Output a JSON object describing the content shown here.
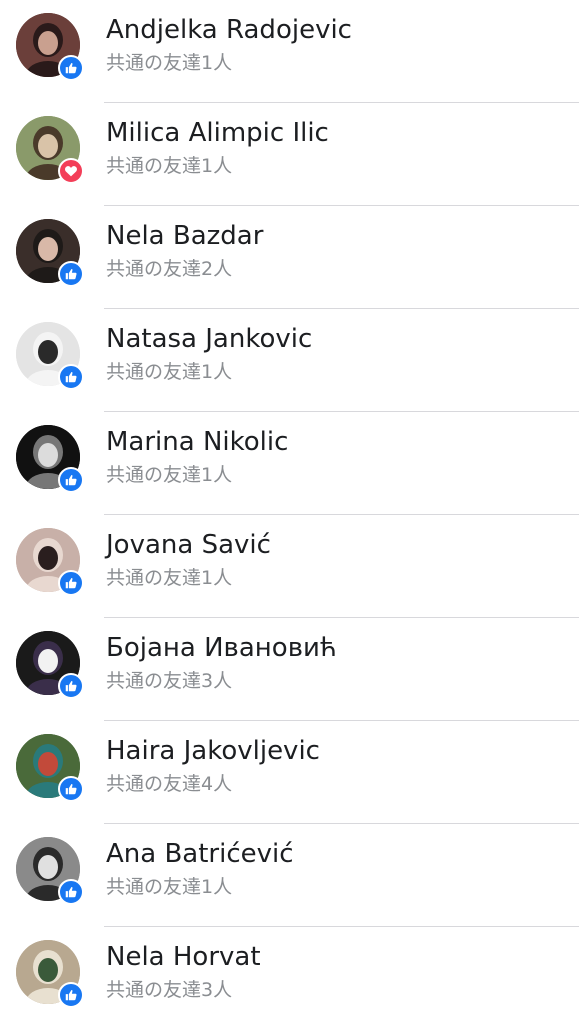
{
  "colors": {
    "like_badge": "#1877f2",
    "love_badge": "#f33e58",
    "name_text": "#1c1e21",
    "secondary_text": "#8a8d91",
    "divider": "#d8d8dc"
  },
  "reactors": [
    {
      "name": "Andjelka Radojevic",
      "mutual": "共通の友達1人",
      "reaction": "like",
      "avatar": [
        "#6b3f3a",
        "#c9a08f",
        "#2a1a1a"
      ]
    },
    {
      "name": "Milica Alimpic Ilic",
      "mutual": "共通の友達1人",
      "reaction": "love",
      "avatar": [
        "#8a9a6a",
        "#d9c3a8",
        "#4a3a2a"
      ]
    },
    {
      "name": "Nela Bazdar",
      "mutual": "共通の友達2人",
      "reaction": "like",
      "avatar": [
        "#3a2e2a",
        "#d8b8a8",
        "#1e1a18"
      ]
    },
    {
      "name": "Natasa Jankovic",
      "mutual": "共通の友達1人",
      "reaction": "like",
      "avatar": [
        "#e4e4e4",
        "#2a2a2a",
        "#f4f4f4"
      ]
    },
    {
      "name": "Marina Nikolic",
      "mutual": "共通の友達1人",
      "reaction": "like",
      "avatar": [
        "#111111",
        "#dcdcdc",
        "#777777"
      ]
    },
    {
      "name": "Jovana Savić",
      "mutual": "共通の友達1人",
      "reaction": "like",
      "avatar": [
        "#c8b0a8",
        "#2a1e1e",
        "#e8d8d0"
      ]
    },
    {
      "name": "Бојана Ивановић",
      "mutual": "共通の友達3人",
      "reaction": "like",
      "avatar": [
        "#1a1a1a",
        "#f2f2f2",
        "#3a2e4a"
      ]
    },
    {
      "name": "Haira Jakovljevic",
      "mutual": "共通の友達4人",
      "reaction": "like",
      "avatar": [
        "#4a6a3a",
        "#c24a3a",
        "#2a7a7a"
      ]
    },
    {
      "name": "Ana Batrićević",
      "mutual": "共通の友達1人",
      "reaction": "like",
      "avatar": [
        "#8a8a8a",
        "#e0e0e0",
        "#2a2a2a"
      ]
    },
    {
      "name": "Nela Horvat",
      "mutual": "共通の友達3人",
      "reaction": "like",
      "avatar": [
        "#b8a890",
        "#3a5a3a",
        "#e8e0d0"
      ]
    }
  ]
}
